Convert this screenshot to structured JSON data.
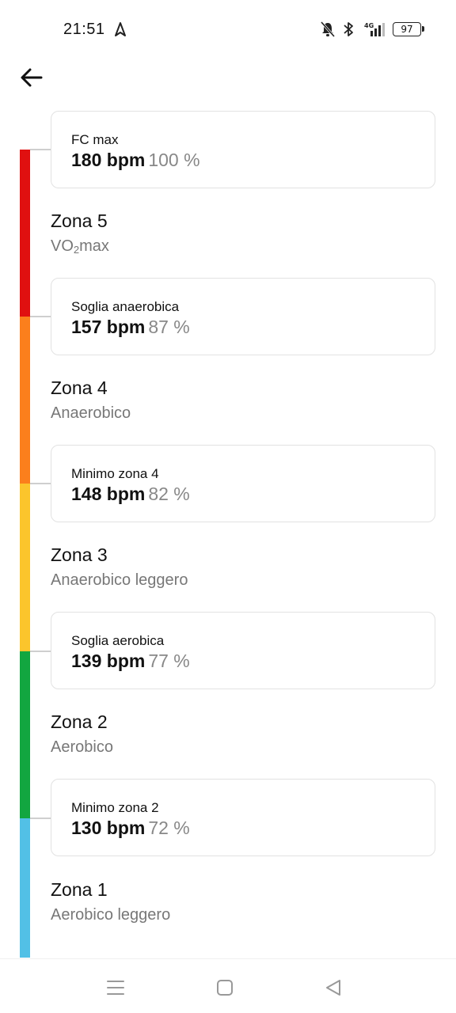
{
  "status": {
    "time": "21:51",
    "battery": "97",
    "network": "4G"
  },
  "header": {
    "back_icon": "arrow-left-icon"
  },
  "zone_colors": {
    "zona5": "#e01010",
    "zona4": "#fb7f1c",
    "zona3": "#fbc52c",
    "zona2": "#12a640",
    "zona1": "#52c0e6"
  },
  "thresholds": [
    {
      "title": "FC max",
      "bpm": "180 bpm",
      "pct": "100 %"
    },
    {
      "title": "Soglia anaerobica",
      "bpm": "157 bpm",
      "pct": "87 %"
    },
    {
      "title": "Minimo zona 4",
      "bpm": "148 bpm",
      "pct": "82 %"
    },
    {
      "title": "Soglia aerobica",
      "bpm": "139 bpm",
      "pct": "77 %"
    },
    {
      "title": "Minimo zona 2",
      "bpm": "130 bpm",
      "pct": "72 %"
    }
  ],
  "zones": [
    {
      "name": "Zona 5",
      "desc_main": "VO",
      "desc_sub": "2",
      "desc_tail": "max"
    },
    {
      "name": "Zona 4",
      "desc": "Anaerobico"
    },
    {
      "name": "Zona 3",
      "desc": "Anaerobico leggero"
    },
    {
      "name": "Zona 2",
      "desc": "Aerobico"
    },
    {
      "name": "Zona 1",
      "desc": "Aerobico leggero"
    }
  ],
  "navbar": {
    "menu_icon": "menu-icon",
    "home_icon": "home-square-icon",
    "back_icon": "back-triangle-icon"
  }
}
